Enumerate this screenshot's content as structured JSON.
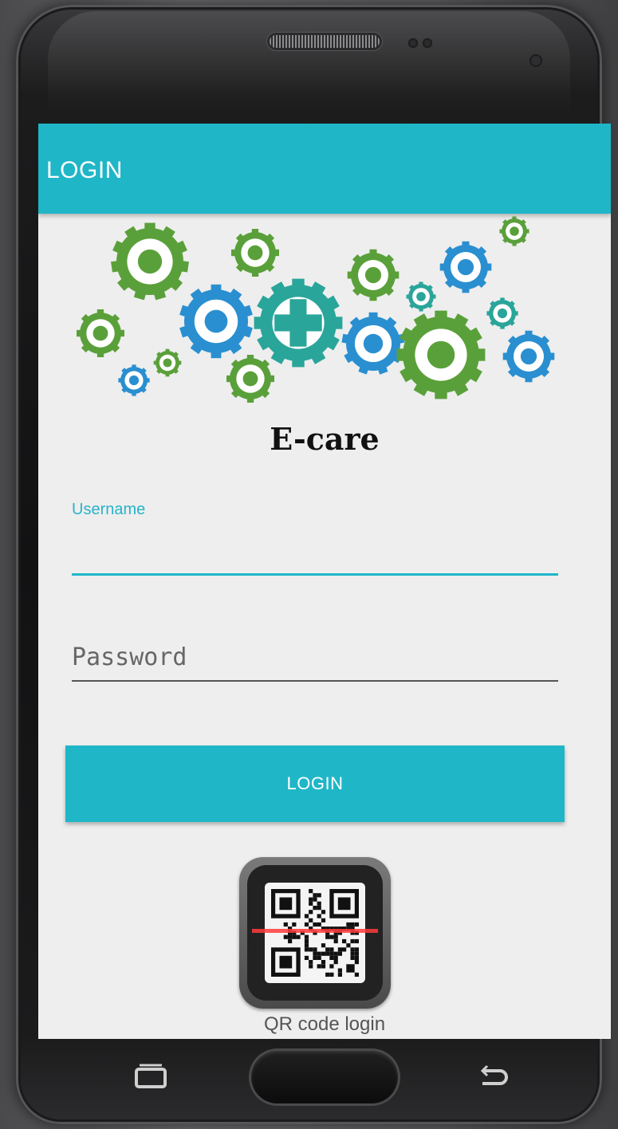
{
  "app_bar": {
    "title": "LOGIN"
  },
  "branding": {
    "app_name": "E-care"
  },
  "form": {
    "username": {
      "label": "Username",
      "value": ""
    },
    "password": {
      "placeholder": "Password",
      "value": ""
    },
    "login_button": "LOGIN"
  },
  "qr": {
    "label": "QR code login"
  },
  "colors": {
    "accent": "#1fb6c8",
    "gear_green": "#5aa03a",
    "gear_blue": "#2a8fd0",
    "gear_teal": "#2aa59a"
  },
  "nav": {
    "recents_icon": "recent-apps-icon",
    "home_icon": "home-icon",
    "back_icon": "back-icon"
  }
}
